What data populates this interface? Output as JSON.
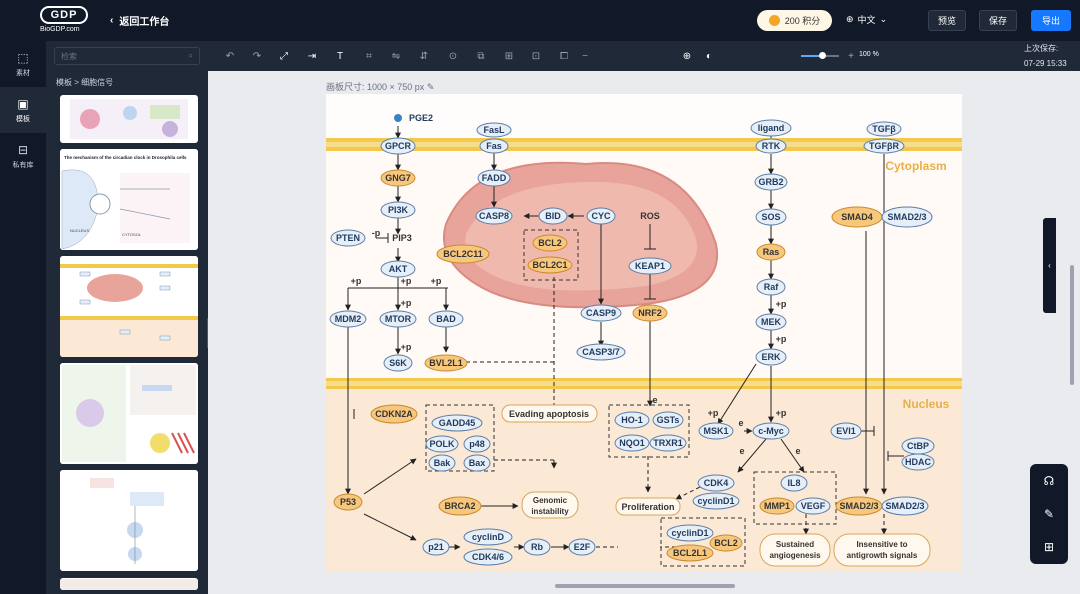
{
  "app": {
    "logo_text": "GDP",
    "logo_sub": "BioGDP.com",
    "back_label": "返回工作台",
    "points_label": "200 积分",
    "language": "中文",
    "preview_label": "预览",
    "save_label": "保存",
    "export_label": "导出"
  },
  "rail": [
    {
      "label": "素材"
    },
    {
      "label": "模板"
    },
    {
      "label": "私有库"
    }
  ],
  "panel": {
    "search_placeholder": "检索",
    "breadcrumb": "模板 > 细胞信号",
    "thumb2_title": "The mechanism of the circadian clock in Drosophila cells",
    "thumb2_label1": "NUCLEUS",
    "thumb2_label2": "CYTOSOL"
  },
  "toolbar": {
    "zoom": "100 %",
    "last_saved_label": "上次保存:",
    "last_saved_time": "07-29 15:33"
  },
  "canvas": {
    "size_label": "画板尺寸: 1000 × 750 px"
  },
  "diagram": {
    "regions": {
      "cytoplasm": "Cytoplasm",
      "nucleus": "Nucleus"
    },
    "nodes": {
      "pge2": "PGE2",
      "gpcr": "GPCR",
      "gng7": "GNG7",
      "pi3k": "PI3K",
      "pten": "PTEN",
      "pip3": "PIP3",
      "akt": "AKT",
      "mdm2": "MDM2",
      "mtor": "MTOR",
      "bad": "BAD",
      "s6k": "S6K",
      "bvl2l1": "BVL2L1",
      "fasl": "FasL",
      "fas": "Fas",
      "fadd": "FADD",
      "casp8": "CASP8",
      "bid": "BID",
      "cyc": "CYC",
      "ros": "ROS",
      "bcl2": "BCL2",
      "bcl2c1": "BCL2C1",
      "bcl2c11": "BCL2C11",
      "keap1": "KEAP1",
      "casp9": "CASP9",
      "nrf2": "NRF2",
      "casp37": "CASP3/7",
      "ligand": "ligand",
      "rtk": "RTK",
      "grb2": "GRB2",
      "sos": "SOS",
      "ras": "Ras",
      "raf": "Raf",
      "mek": "MEK",
      "erk": "ERK",
      "tgfb": "TGFβ",
      "tgfbr": "TGFβR",
      "smad4": "SMAD4",
      "smad23": "SMAD2/3",
      "cdkn2a": "CDKN2A",
      "gadd45": "GADD45",
      "polk": "POLK",
      "p48": "p48",
      "bak": "Bak",
      "bax": "Bax",
      "evading": "Evading apoptosis",
      "ho1": "HO-1",
      "gsts": "GSTs",
      "nqo1": "NQO1",
      "trxr1": "TRXR1",
      "msk1": "MSK1",
      "cmyc": "c-Myc",
      "evi1": "EVI1",
      "ctbp": "CtBP",
      "hdac": "HDAC",
      "p53": "P53",
      "brca2": "BRCA2",
      "genomic": "Genomic instability",
      "prolif": "Proliferation",
      "cdk4": "CDK4",
      "cyclind1": "cyclinD1",
      "il8": "IL8",
      "mmp1": "MMP1",
      "vegf": "VEGF",
      "smad23n": "SMAD2/3",
      "smad23b": "SMAD2/3",
      "p21": "p21",
      "cyclind": "cyclinD",
      "cdk46": "CDK4/6",
      "rb": "Rb",
      "e2f": "E2F",
      "cyclind1b": "cyclinD1",
      "bcl2b": "BCL2",
      "bcl2l1": "BCL2L1",
      "sustained": "Sustained angiogenesis",
      "insensitive": "Insensitive to antigrowth signals"
    },
    "edge_labels": {
      "plus_p": "+p",
      "minus_p": "-p",
      "e": "e"
    }
  },
  "colors": {
    "accent": "#1677ff",
    "topbar": "#111827",
    "membrane": "#f2c94c",
    "nucleus_bg": "#fbe9d6",
    "mito": "#e8a49b",
    "cytoplasm_title": "#e8b04a"
  }
}
